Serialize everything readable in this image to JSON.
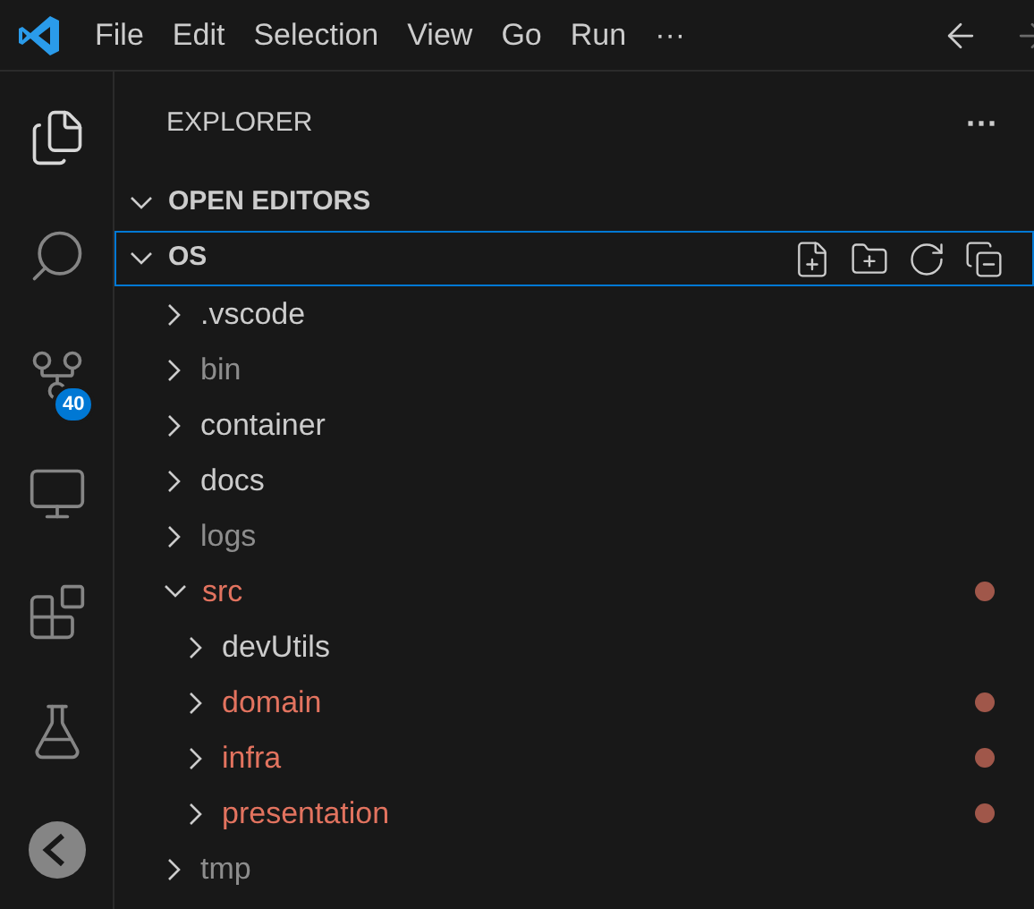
{
  "menu": [
    "File",
    "Edit",
    "Selection",
    "View",
    "Go",
    "Run",
    "···"
  ],
  "activity_bar": [
    {
      "kind": "explorer",
      "selected": true
    },
    {
      "kind": "search",
      "selected": false
    },
    {
      "kind": "source-control",
      "selected": false,
      "badge": "40"
    },
    {
      "kind": "remote",
      "selected": false
    },
    {
      "kind": "extensions",
      "selected": false
    },
    {
      "kind": "testing",
      "selected": false
    },
    {
      "kind": "extension-view",
      "selected": false
    }
  ],
  "sidebar": {
    "title": "EXPLORER",
    "more": "···",
    "sections": [
      {
        "title": "OPEN EDITORS",
        "expanded": true,
        "focused": false
      },
      {
        "title": "OS",
        "expanded": true,
        "focused": true
      }
    ]
  },
  "tree": [
    {
      "name": ".vscode",
      "modified": false,
      "ignored": false,
      "expanded": false
    },
    {
      "name": "bin",
      "modified": false,
      "ignored": true,
      "expanded": false
    },
    {
      "name": "container",
      "modified": false,
      "ignored": false,
      "expanded": false
    },
    {
      "name": "docs",
      "modified": false,
      "ignored": false,
      "expanded": false
    },
    {
      "name": "logs",
      "modified": false,
      "ignored": true,
      "expanded": false
    },
    {
      "name": "src",
      "modified": true,
      "ignored": false,
      "expanded": true,
      "children": [
        {
          "name": "devUtils",
          "modified": false,
          "ignored": false,
          "expanded": false
        },
        {
          "name": "domain",
          "modified": true,
          "ignored": false,
          "expanded": false
        },
        {
          "name": "infra",
          "modified": true,
          "ignored": false,
          "expanded": false
        },
        {
          "name": "presentation",
          "modified": true,
          "ignored": false,
          "expanded": false
        }
      ]
    },
    {
      "name": "tmp",
      "modified": false,
      "ignored": true,
      "expanded": false
    }
  ]
}
